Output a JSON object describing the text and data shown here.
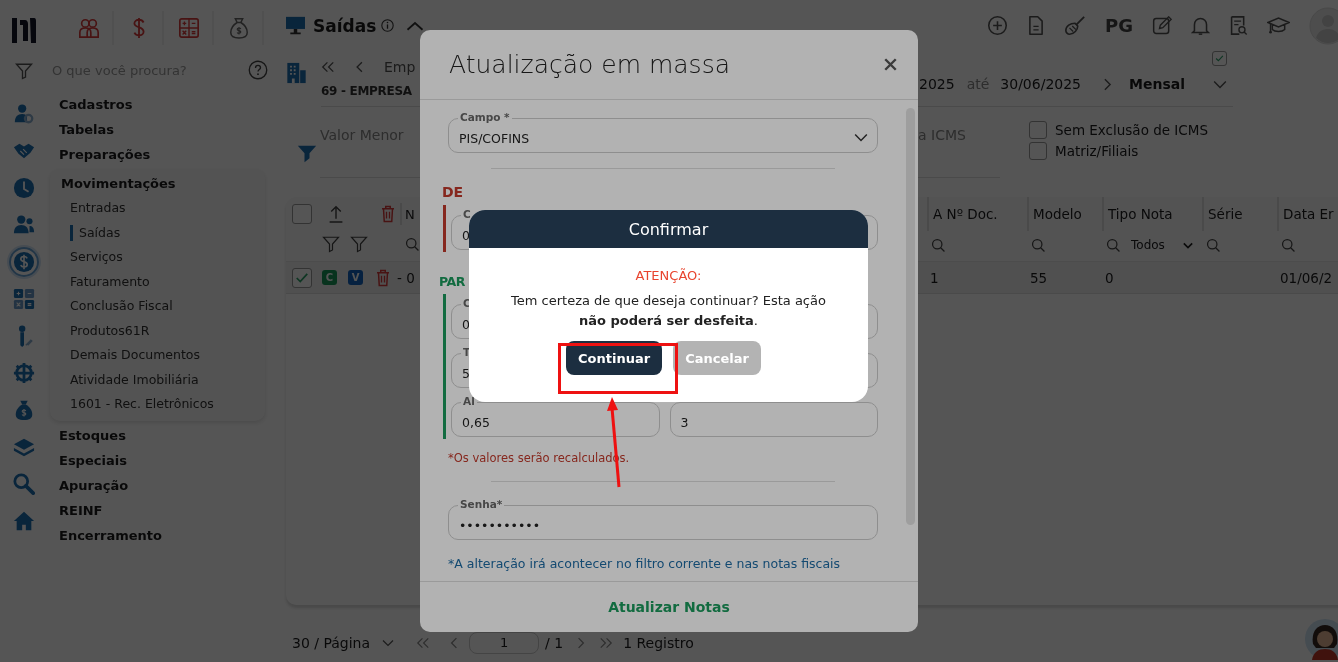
{
  "rail_items": [
    {
      "selected": false
    },
    {
      "selected": false
    },
    {
      "selected": false
    },
    {
      "selected": false
    },
    {
      "selected": true
    },
    {
      "selected": false
    },
    {
      "selected": false
    },
    {
      "selected": false
    },
    {
      "selected": false
    },
    {
      "selected": false
    },
    {
      "selected": false
    },
    {
      "selected": false
    }
  ],
  "search": {
    "placeholder": "O que você procura?"
  },
  "menu": [
    {
      "label": "Cadastros",
      "expanded": false
    },
    {
      "label": "Tabelas",
      "expanded": false
    },
    {
      "label": "Preparações",
      "expanded": false
    },
    {
      "label": "Movimentações",
      "expanded": true,
      "children": [
        {
          "label": "Entradas",
          "selected": false
        },
        {
          "label": "Saídas",
          "selected": true
        },
        {
          "label": "Serviços",
          "selected": false
        },
        {
          "label": "Faturamento",
          "selected": false
        },
        {
          "label": "Conclusão Fiscal",
          "selected": false
        },
        {
          "label": "Produtos61R",
          "selected": false
        },
        {
          "label": "Demais Documentos",
          "selected": false
        },
        {
          "label": "Atividade Imobiliária",
          "selected": false
        },
        {
          "label": "1601 - Rec. Eletrônicos",
          "selected": false
        }
      ]
    },
    {
      "label": "Estoques",
      "expanded": false
    },
    {
      "label": "Especiais",
      "expanded": false
    },
    {
      "label": "Apuração",
      "expanded": false
    },
    {
      "label": "REINF",
      "expanded": false
    },
    {
      "label": "Encerramento",
      "expanded": false
    }
  ],
  "header": {
    "title": "Saídas",
    "shortcut_label": "PG"
  },
  "filters": {
    "company_nav": "Emp",
    "company": "69 - EMPRESA",
    "min_value_label": "Valor Menor",
    "date_from": "2025",
    "date_separator": "até",
    "date_to": "30/06/2025",
    "period": "Mensal",
    "period_checked": true,
    "icms_label": "a ICMS",
    "options": [
      {
        "label": "Sem Exclusão de ICMS",
        "checked": false
      },
      {
        "label": "Matriz/Filiais",
        "checked": false
      }
    ]
  },
  "table": {
    "header_checked": false,
    "left_column": "N",
    "columns": [
      {
        "label": "A Nº Doc."
      },
      {
        "label": "Modelo"
      },
      {
        "label": "Tipo Nota",
        "filter": "Todos"
      },
      {
        "label": "Série"
      },
      {
        "label": "Data Er"
      }
    ],
    "rows": [
      {
        "checked": true,
        "tags": [
          {
            "text": "C",
            "kind": "green"
          },
          {
            "text": "V",
            "kind": "blue"
          }
        ],
        "left_cell": "- 0",
        "cells": [
          "1",
          "55",
          "0",
          null,
          "01/06/2"
        ]
      }
    ]
  },
  "pagination": {
    "page_size": "30 / Página",
    "page": "1",
    "total_pages": "/ 1",
    "records": "1 Registro"
  },
  "modal": {
    "title": "Atualização em massa",
    "field": {
      "label": "Campo *",
      "value": "PIS/COFINS"
    },
    "from": {
      "heading": "DE",
      "fields": [
        {
          "label": "C",
          "value": "0"
        }
      ]
    },
    "to": {
      "heading": "PAR",
      "fields": [
        {
          "kind": "input",
          "label": "C",
          "value": "0"
        },
        {
          "kind": "select"
        },
        {
          "kind": "input",
          "label": "T",
          "value": "5"
        },
        {
          "kind": "select"
        },
        {
          "kind": "input",
          "label": "Al",
          "value": "0,65"
        },
        {
          "kind": "input",
          "value": "3"
        }
      ]
    },
    "recalc_note": "*Os valores serão recalculados.",
    "password": {
      "label": "Senha*",
      "value": "•••••••••••"
    },
    "scope_note": "*A alteração irá acontecer no filtro corrente e nas notas fiscais",
    "submit": "Atualizar Notas"
  },
  "confirm": {
    "title": "Confirmar",
    "warning": "ATENÇÃO:",
    "message": "Tem certeza de que deseja continuar? Esta ação **não poderá ser desfeita**.",
    "buttons": [
      {
        "label": "Continuar",
        "kind": "primary"
      },
      {
        "label": "Cancelar",
        "kind": "secondary"
      }
    ]
  }
}
